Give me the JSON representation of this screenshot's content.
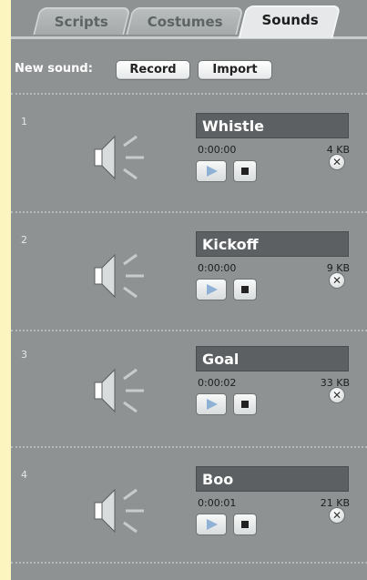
{
  "tabs": [
    {
      "label": "Scripts",
      "active": false
    },
    {
      "label": "Costumes",
      "active": false
    },
    {
      "label": "Sounds",
      "active": true
    }
  ],
  "toolbar": {
    "new_sound_label": "New sound:",
    "record_label": "Record",
    "import_label": "Import"
  },
  "sounds": [
    {
      "index": "1",
      "name": "Whistle",
      "duration": "0:00:00",
      "size": "4 KB"
    },
    {
      "index": "2",
      "name": "Kickoff",
      "duration": "0:00:00",
      "size": "9 KB"
    },
    {
      "index": "3",
      "name": "Goal",
      "duration": "0:00:02",
      "size": "33 KB"
    },
    {
      "index": "4",
      "name": "Boo",
      "duration": "0:00:01",
      "size": "21 KB"
    }
  ],
  "icons": {
    "speaker": "speaker-icon",
    "play": "play-icon",
    "stop": "stop-icon",
    "delete": "delete-icon"
  },
  "colors": {
    "pane": "#8e9293",
    "name_box": "#5c6062",
    "background": "#fdf5c0"
  }
}
